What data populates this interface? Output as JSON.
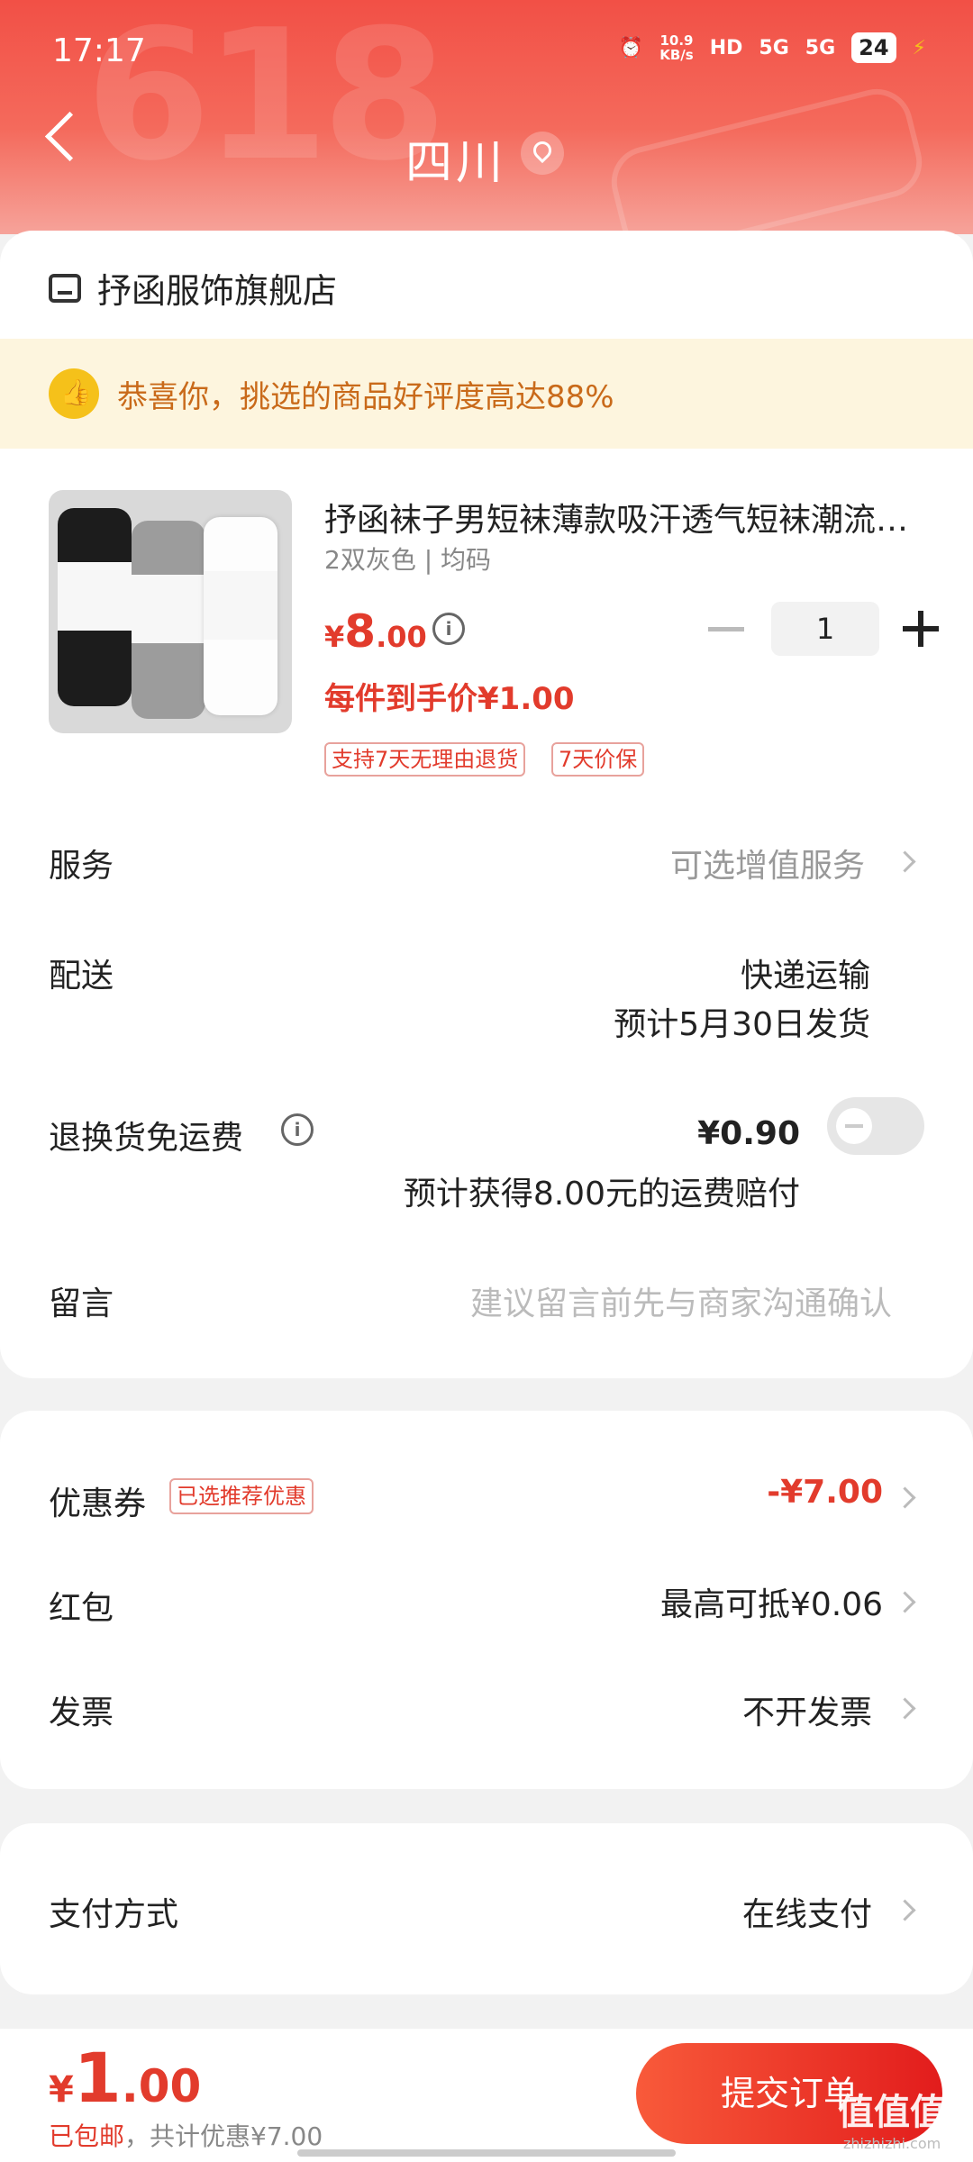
{
  "status_bar": {
    "time": "17:17",
    "net_speed_value": "10.9",
    "net_speed_unit": "KB/s",
    "hd": "HD",
    "signal1": "5G",
    "signal2": "5G",
    "battery": "24"
  },
  "header": {
    "title": "四川",
    "background_text": "618",
    "background_color": "#f25046"
  },
  "shop": {
    "name": "抒函服饰旗舰店"
  },
  "banner": {
    "text": "恭喜你，挑选的商品好评度高达88%"
  },
  "product": {
    "title": "抒函袜子男短袜薄款吸汗透气短袜潮流…",
    "variant": "2双灰色 | 均码",
    "price_currency": "¥",
    "price_int": "8",
    "price_dec": ".00",
    "quantity": "1",
    "unit_price": "每件到手价¥1.00",
    "tags": [
      "支持7天无理由退货",
      "7天价保"
    ]
  },
  "service": {
    "label": "服务",
    "value": "可选增值服务"
  },
  "delivery": {
    "label": "配送",
    "method": "快递运输",
    "eta": "预计5月30日发货"
  },
  "return_shipping": {
    "label": "退换货免运费",
    "price": "¥0.90",
    "note": "预计获得8.00元的运费赔付",
    "enabled": false
  },
  "message": {
    "label": "留言",
    "placeholder": "建议留言前先与商家沟通确认"
  },
  "coupon": {
    "label": "优惠券",
    "tag": "已选推荐优惠",
    "value": "-¥7.00"
  },
  "red_packet": {
    "label": "红包",
    "value": "最高可抵¥0.06"
  },
  "invoice": {
    "label": "发票",
    "value": "不开发票"
  },
  "payment": {
    "label": "支付方式",
    "value": "在线支付"
  },
  "footer": {
    "total_currency": "¥",
    "total_int": "1",
    "total_dec": ".00",
    "shipping": "已包邮",
    "discount_note": "，共计优惠¥7.00",
    "submit": "提交订单",
    "watermark": "值值值",
    "watermark_sub": "zhizhizhi.com"
  },
  "colors": {
    "accent": "#e23b2c",
    "banner_bg": "#fdf5de",
    "banner_text": "#c96a1a"
  }
}
